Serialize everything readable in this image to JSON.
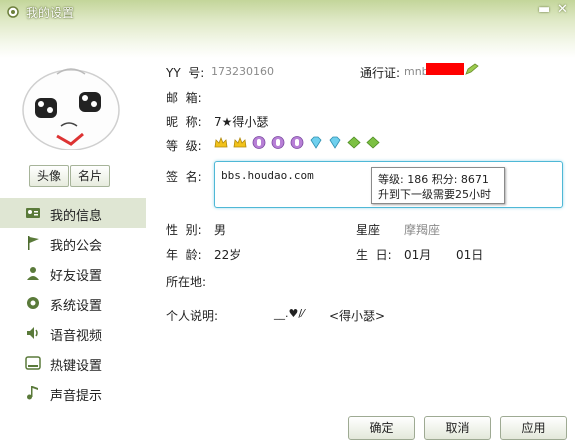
{
  "window": {
    "title": "我的设置"
  },
  "avatar_buttons": {
    "avatar": "头像",
    "card": "名片"
  },
  "nav": [
    {
      "label": "我的信息",
      "icon": "id-card-icon",
      "active": true
    },
    {
      "label": "我的公会",
      "icon": "flag-icon"
    },
    {
      "label": "好友设置",
      "icon": "person-icon"
    },
    {
      "label": "系统设置",
      "icon": "gear-icon"
    },
    {
      "label": "语音视频",
      "icon": "speaker-icon"
    },
    {
      "label": "热键设置",
      "icon": "keyboard-icon"
    },
    {
      "label": "声音提示",
      "icon": "music-note-icon"
    }
  ],
  "profile": {
    "yy_label": "YY  号:",
    "yy_value": "173230160",
    "passport_label": "通行证:",
    "passport_value": "mnb",
    "email_label": "邮  箱:",
    "nickname_label": "昵  称:",
    "nickname_value": "7★得小瑟",
    "level_label": "等  级:",
    "signature_label": "签  名:",
    "signature_value": "bbs.houdao.com",
    "tooltip_line1": "等级: 186 积分: 8671",
    "tooltip_line2": "升到下一级需要25小时",
    "gender_label": "性  别:",
    "gender_value": "男",
    "constellation_label": "星座",
    "constellation_value": "摩羯座",
    "age_label": "年  龄:",
    "age_value": "22岁",
    "birthday_label": "生  日:",
    "birthday_month": "01月",
    "birthday_day": "01日",
    "location_label": "所在地:",
    "note_label": "个人说明:",
    "note_value": "__.♥/⁄",
    "note_value2": "<得小瑟>"
  },
  "level_icons": [
    "crown-icon",
    "crown-icon",
    "moon-icon",
    "moon-icon",
    "moon-icon",
    "diamond-icon",
    "diamond-icon",
    "clover-icon",
    "clover-icon"
  ],
  "buttons": {
    "ok": "确定",
    "cancel": "取消",
    "apply": "应用"
  },
  "colors": {
    "accent": "#4fb8d6",
    "redact": "#ff0000",
    "nav_active": "#dfe6d3"
  }
}
